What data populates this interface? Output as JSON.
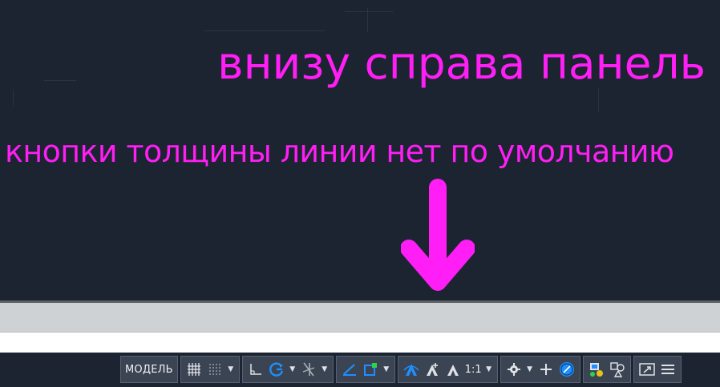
{
  "annotations": {
    "line1": "внизу справа панель",
    "line2": "кнопки толщины линии нет по умолчанию"
  },
  "statusbar": {
    "model_label": "МОДЕЛЬ",
    "scale_label": "1:1",
    "icons": [
      "grid-icon",
      "snap-icon",
      "ortho-icon",
      "polar-tracking-icon",
      "isometric-icon",
      "object-snap-tracking-icon",
      "object-snap-icon",
      "annotation-visibility-icon",
      "auto-scale-icon",
      "annotation-scale-icon",
      "gear-icon",
      "plus-icon",
      "units-icon",
      "isolate-objects-icon",
      "graphics-performance-icon",
      "fullscreen-icon",
      "hamburger-menu-icon"
    ]
  },
  "colors": {
    "annotation": "#ff1ef5",
    "canvas": "#1b2430",
    "status_button": "#3b4453",
    "accent_blue": "#1e8fff"
  }
}
